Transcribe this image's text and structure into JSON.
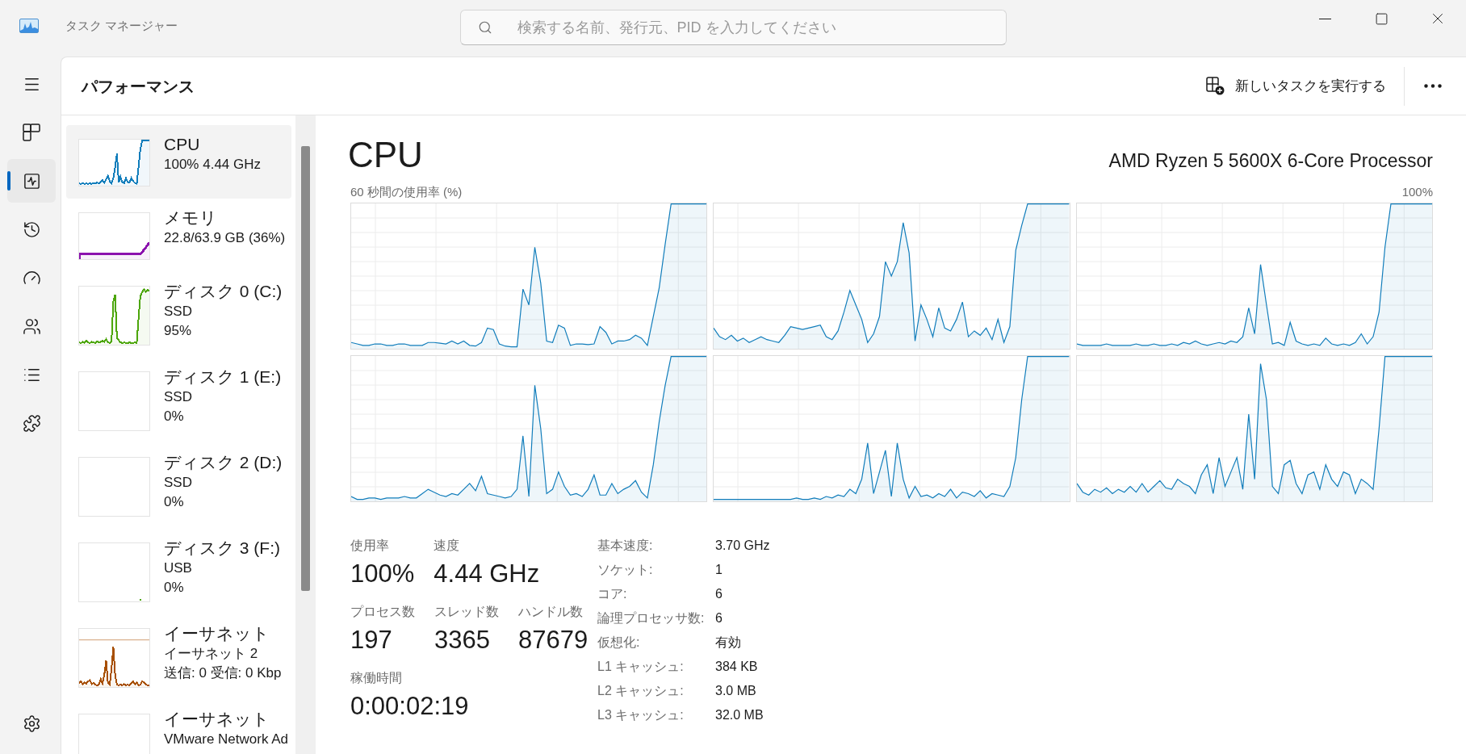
{
  "window": {
    "title": "タスク マネージャー"
  },
  "search": {
    "placeholder": "検索する名前、発行元、PID を入力してください"
  },
  "nav": {
    "items": [
      {
        "kind": "processes",
        "selected": false
      },
      {
        "kind": "performance",
        "selected": true
      },
      {
        "kind": "history",
        "selected": false
      },
      {
        "kind": "startup",
        "selected": false
      },
      {
        "kind": "users",
        "selected": false
      },
      {
        "kind": "details",
        "selected": false
      },
      {
        "kind": "services",
        "selected": false
      },
      {
        "kind": "settings",
        "selected": false
      }
    ]
  },
  "page": {
    "title": "パフォーマンス",
    "actions": [
      {
        "label": "新しいタスクを実行する"
      }
    ]
  },
  "resources": {
    "items": [
      {
        "title": "CPU",
        "lines": [
          "100% 4.44 GHz"
        ],
        "selected": true,
        "color": "#117dbb"
      },
      {
        "title": "メモリ",
        "lines": [
          "22.8/63.9 GB (36%)"
        ],
        "selected": false,
        "color": "#8b12ae"
      },
      {
        "title": "ディスク 0 (C:)",
        "lines": [
          "SSD",
          "95%"
        ],
        "selected": false,
        "color": "#4da60c"
      },
      {
        "title": "ディスク 1 (E:)",
        "lines": [
          "SSD",
          "0%"
        ],
        "selected": false
      },
      {
        "title": "ディスク 2 (D:)",
        "lines": [
          "SSD",
          "0%"
        ],
        "selected": false
      },
      {
        "title": "ディスク 3 (F:)",
        "lines": [
          "USB",
          "0%"
        ],
        "selected": false,
        "color": "#4da60c"
      },
      {
        "title": "イーサネット",
        "lines": [
          "イーサネット 2",
          "送信: 0 受信: 0 Kbp"
        ],
        "selected": false,
        "color": "#a74f01"
      },
      {
        "title": "イーサネット",
        "lines": [
          "VMware Network Ad"
        ],
        "selected": false
      }
    ]
  },
  "main": {
    "title": "CPU",
    "model": "AMD Ryzen 5 5600X 6-Core Processor",
    "graph_caption": "60 秒間の使用率 (%)",
    "graph_max": "100%",
    "stats": [
      [
        {
          "label": "使用率",
          "value": "100%"
        },
        {
          "label": "速度",
          "value": "4.44 GHz"
        }
      ],
      [
        {
          "label": "プロセス数",
          "value": "197"
        },
        {
          "label": "スレッド数",
          "value": "3365"
        },
        {
          "label": "ハンドル数",
          "value": "87679"
        }
      ],
      [
        {
          "label": "稼働時間",
          "value": "0:00:02:19"
        }
      ]
    ],
    "specs": [
      {
        "label": "基本速度:",
        "value": "3.70 GHz"
      },
      {
        "label": "ソケット:",
        "value": "1"
      },
      {
        "label": "コア:",
        "value": "6"
      },
      {
        "label": "論理プロセッサ数:",
        "value": "6"
      },
      {
        "label": "仮想化:",
        "value": "有効"
      },
      {
        "label": "L1 キャッシュ:",
        "value": "384 KB"
      },
      {
        "label": "L2 キャッシュ:",
        "value": "3.0 MB"
      },
      {
        "label": "L3 キャッシュ:",
        "value": "32.0 MB"
      }
    ]
  }
}
